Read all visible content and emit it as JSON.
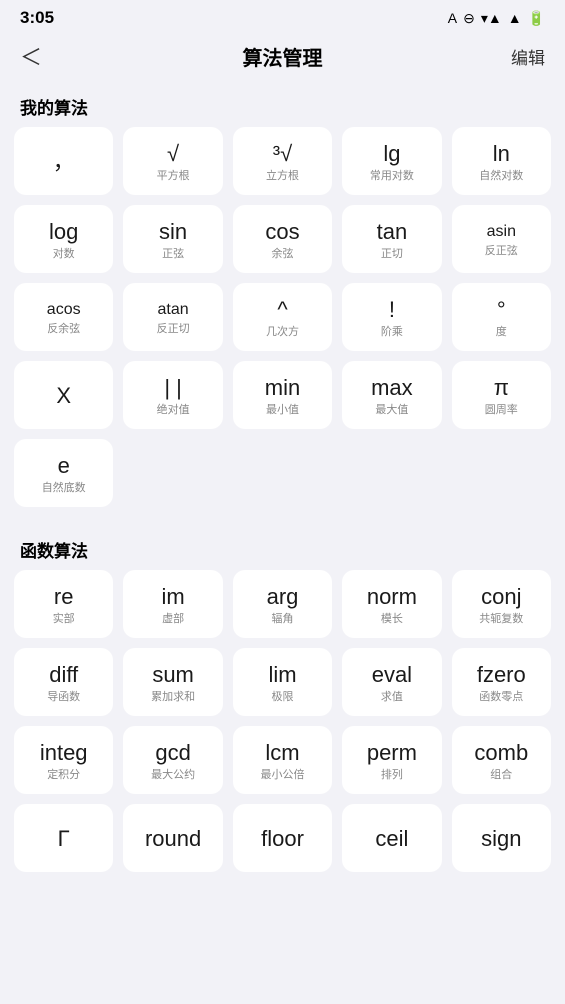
{
  "statusBar": {
    "time": "3:05",
    "icons": [
      "A",
      "⊖",
      "▾",
      "▲",
      "🔋"
    ]
  },
  "header": {
    "back": "＜",
    "title": "算法管理",
    "edit": "编辑"
  },
  "myAlgorithms": {
    "label": "我的算法",
    "items": [
      {
        "main": "，",
        "sub": "",
        "size": "large"
      },
      {
        "main": "√",
        "sub": "平方根",
        "size": "large"
      },
      {
        "main": "³√",
        "sub": "立方根",
        "size": "large"
      },
      {
        "main": "lg",
        "sub": "常用对数",
        "size": "large"
      },
      {
        "main": "ln",
        "sub": "自然对数",
        "size": "large"
      },
      {
        "main": "log",
        "sub": "对数",
        "size": "large"
      },
      {
        "main": "sin",
        "sub": "正弦",
        "size": "large"
      },
      {
        "main": "cos",
        "sub": "余弦",
        "size": "large"
      },
      {
        "main": "tan",
        "sub": "正切",
        "size": "large"
      },
      {
        "main": "asin",
        "sub": "反正弦",
        "size": "small"
      },
      {
        "main": "acos",
        "sub": "反余弦",
        "size": "small"
      },
      {
        "main": "atan",
        "sub": "反正切",
        "size": "small"
      },
      {
        "main": "^",
        "sub": "几次方",
        "size": "large"
      },
      {
        "main": "!",
        "sub": "阶乘",
        "size": "large"
      },
      {
        "main": "°",
        "sub": "度",
        "size": "large"
      },
      {
        "main": "X",
        "sub": "",
        "size": "large"
      },
      {
        "main": "| |",
        "sub": "绝对值",
        "size": "large"
      },
      {
        "main": "min",
        "sub": "最小值",
        "size": "large"
      },
      {
        "main": "max",
        "sub": "最大值",
        "size": "large"
      },
      {
        "main": "π",
        "sub": "圆周率",
        "size": "large"
      },
      {
        "main": "e",
        "sub": "自然底数",
        "size": "large"
      }
    ]
  },
  "funcAlgorithms": {
    "label": "函数算法",
    "items": [
      {
        "main": "re",
        "sub": "实部",
        "size": "large"
      },
      {
        "main": "im",
        "sub": "虚部",
        "size": "large"
      },
      {
        "main": "arg",
        "sub": "辐角",
        "size": "large"
      },
      {
        "main": "norm",
        "sub": "模长",
        "size": "large"
      },
      {
        "main": "conj",
        "sub": "共轭复数",
        "size": "large"
      },
      {
        "main": "diff",
        "sub": "导函数",
        "size": "large"
      },
      {
        "main": "sum",
        "sub": "累加求和",
        "size": "large"
      },
      {
        "main": "lim",
        "sub": "极限",
        "size": "large"
      },
      {
        "main": "eval",
        "sub": "求值",
        "size": "large"
      },
      {
        "main": "fzero",
        "sub": "函数零点",
        "size": "large"
      },
      {
        "main": "integ",
        "sub": "定积分",
        "size": "large"
      },
      {
        "main": "gcd",
        "sub": "最大公约",
        "size": "large"
      },
      {
        "main": "lcm",
        "sub": "最小公倍",
        "size": "large"
      },
      {
        "main": "perm",
        "sub": "排列",
        "size": "large"
      },
      {
        "main": "comb",
        "sub": "组合",
        "size": "large"
      },
      {
        "main": "Γ",
        "sub": "",
        "size": "large"
      },
      {
        "main": "round",
        "sub": "",
        "size": "large"
      },
      {
        "main": "floor",
        "sub": "",
        "size": "large"
      },
      {
        "main": "ceil",
        "sub": "",
        "size": "large"
      },
      {
        "main": "sign",
        "sub": "",
        "size": "large"
      }
    ]
  }
}
